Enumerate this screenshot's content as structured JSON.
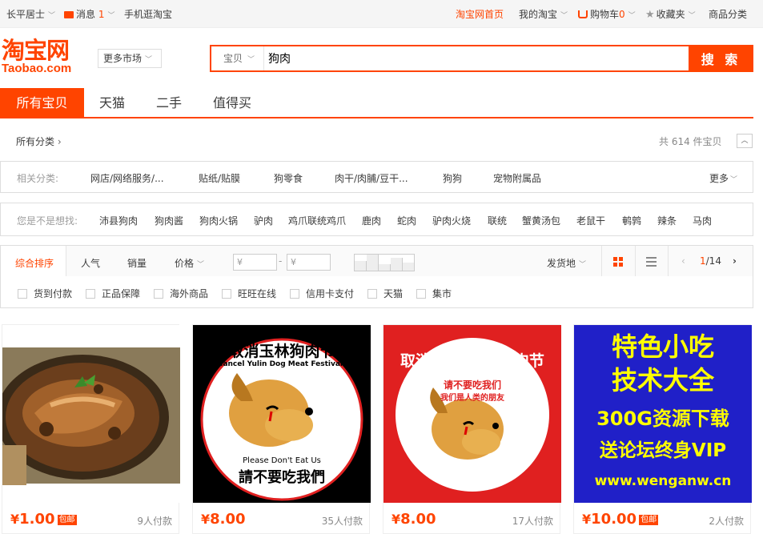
{
  "topbar": {
    "user": "长平居士",
    "messages_label": "消息",
    "messages_count": "1",
    "mobile": "手机逛淘宝",
    "home": "淘宝网首页",
    "my_taobao": "我的淘宝",
    "cart_label": "购物车",
    "cart_count": "0",
    "favorites": "收藏夹",
    "categories": "商品分类"
  },
  "logo": {
    "cn": "淘宝网",
    "en": "Taobao.com"
  },
  "market_button": "更多市场",
  "search": {
    "category": "宝贝",
    "query": "狗肉",
    "button": "搜 索"
  },
  "tabs": [
    "所有宝贝",
    "天猫",
    "二手",
    "值得买"
  ],
  "crumb": "所有分类",
  "result_count": "共 614 件宝贝",
  "related": {
    "label": "相关分类:",
    "items": [
      "网店/网络服务/...",
      "贴纸/贴膜",
      "狗零食",
      "肉干/肉脯/豆干...",
      "狗狗",
      "宠物附属品"
    ],
    "more": "更多"
  },
  "suggest": {
    "label": "您是不是想找:",
    "items": [
      "沛县狗肉",
      "狗肉酱",
      "狗肉火锅",
      "驴肉",
      "鸡爪联统鸡爪",
      "鹿肉",
      "蛇肉",
      "驴肉火烧",
      "联统",
      "蟹黄汤包",
      "老鼠干",
      "鹌鹑",
      "辣条",
      "马肉"
    ]
  },
  "sort": {
    "items": [
      "综合排序",
      "人气",
      "销量",
      "价格"
    ],
    "price_min": "¥",
    "price_max": "¥",
    "dash": "-",
    "ship_from": "发货地",
    "page_current": "1",
    "page_total": "/14"
  },
  "filters": [
    "货到付款",
    "正品保障",
    "海外商品",
    "旺旺在线",
    "信用卡支付",
    "天猫",
    "集市"
  ],
  "products": [
    {
      "price": "1.00",
      "yen": "¥",
      "baoyou": "包邮",
      "paid": "9人付款"
    },
    {
      "price": "8.00",
      "yen": "¥",
      "baoyou": "",
      "paid": "35人付款",
      "img_title": "取消玉林狗肉节",
      "img_sub": "Cancel Yulin Dog Meat Festival!",
      "img_foot_en": "Please Don't Eat Us",
      "img_foot_cn": "請不要吃我們"
    },
    {
      "price": "8.00",
      "yen": "¥",
      "baoyou": "",
      "paid": "17人付款",
      "img_title": "取消6·21玉林狗肉节",
      "img_line1": "请不要吃我们",
      "img_line2": "我们是人类的朋友"
    },
    {
      "price": "10.00",
      "yen": "¥",
      "baoyou": "包邮",
      "paid": "2人付款",
      "img_lines": [
        "特色小吃",
        "技术大全",
        "300G资源下载",
        "送论坛终身VIP",
        "www.wenganw.cn"
      ]
    }
  ],
  "colors": {
    "accent": "#ff4400",
    "poster_red": "#e02020",
    "poster_blue": "#2020c8",
    "poster_yellow": "#ffff00"
  }
}
